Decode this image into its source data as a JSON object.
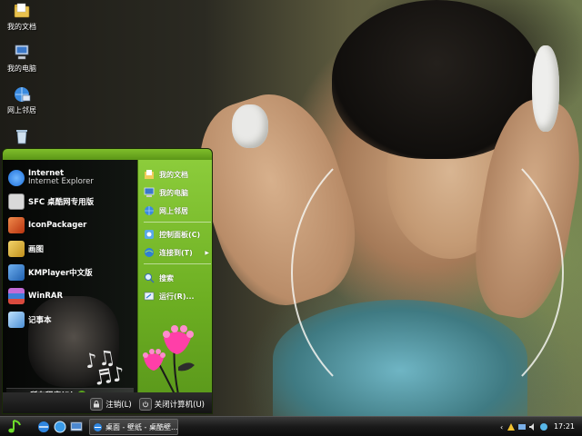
{
  "desktop": {
    "icons": [
      {
        "label": "我的文档",
        "icon": "folder-icon"
      },
      {
        "label": "我的电脑",
        "icon": "computer-icon"
      },
      {
        "label": "网上邻居",
        "icon": "network-icon"
      },
      {
        "label": "",
        "icon": "recycle-bin-icon"
      }
    ]
  },
  "start_menu": {
    "pinned": [
      {
        "title": "Internet",
        "subtitle": "Internet Explorer",
        "icon": "internet-explorer-icon",
        "color": "#1e6fd9"
      },
      {
        "title": "SFC 桌酷网专用版",
        "icon": "sfc-icon",
        "color": "#d9d9d9"
      },
      {
        "title": "IconPackager",
        "icon": "iconpackager-icon",
        "color": "#d84a1b"
      },
      {
        "title": "画图",
        "icon": "paint-icon",
        "color": "#e6c34a"
      },
      {
        "title": "KMPlayer中文版",
        "icon": "kmplayer-icon",
        "color": "#3a7fd0"
      },
      {
        "title": "WinRAR",
        "icon": "winrar-icon",
        "color": "#8a3da0"
      },
      {
        "title": "记事本",
        "icon": "notepad-icon",
        "color": "#5fa9e6"
      }
    ],
    "all_programs": "所有程序(P)",
    "right": [
      {
        "label": "我的文档",
        "icon": "documents-icon"
      },
      {
        "label": "我的电脑",
        "icon": "my-computer-icon"
      },
      {
        "label": "网上邻居",
        "icon": "network-places-icon"
      },
      {
        "label": "控制面板(C)",
        "icon": "control-panel-icon"
      },
      {
        "label": "连接到(T)",
        "icon": "connect-to-icon",
        "submenu": true
      },
      {
        "label": "搜索",
        "icon": "search-icon"
      },
      {
        "label": "运行(R)...",
        "icon": "run-icon"
      }
    ],
    "logoff": "注销(L)",
    "shutdown": "关闭计算机(U)"
  },
  "taskbar": {
    "task": "桌面 - 壁纸 - 桌酷壁...",
    "clock": "17:21"
  },
  "colors": {
    "accent": "#6daf22",
    "taskbar": "#1a1a1a"
  }
}
